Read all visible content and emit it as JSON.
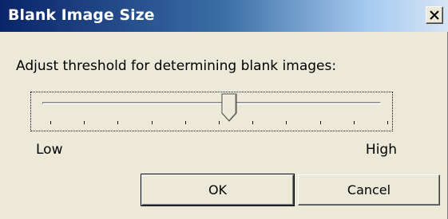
{
  "window": {
    "title": "Blank Image Size",
    "close_icon": "close-x-icon"
  },
  "main": {
    "prompt": "Adjust threshold for determining blank images:",
    "slider": {
      "min_label": "Low",
      "max_label": "High",
      "value_fraction": 0.53,
      "tick_count": 11
    }
  },
  "buttons": {
    "ok_label": "OK",
    "cancel_label": "Cancel"
  },
  "colors": {
    "titlebar_start": "#0a246a",
    "titlebar_end": "#d6e4f4",
    "dialog_bg": "#ece9d8"
  }
}
